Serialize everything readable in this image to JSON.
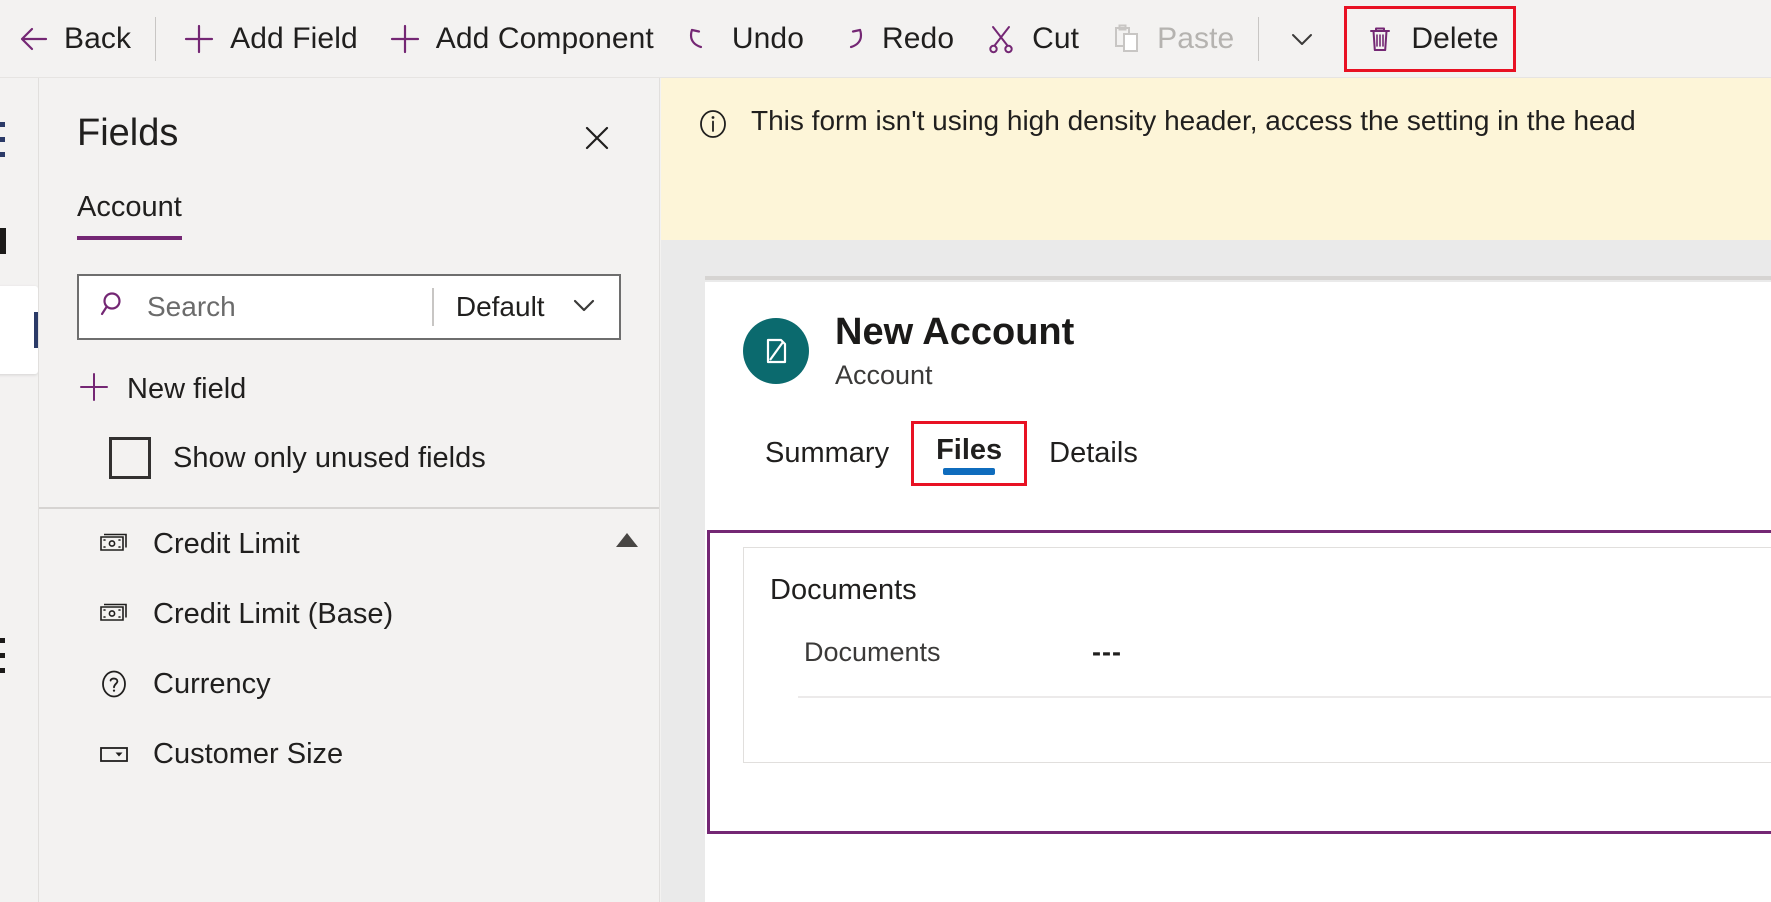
{
  "commandbar": {
    "items": [
      {
        "name": "back",
        "label": "Back",
        "icon": "arrow-left-icon",
        "disabled": false,
        "highlighted": false
      },
      {
        "name": "add-field",
        "label": "Add Field",
        "icon": "plus-icon",
        "disabled": false,
        "highlighted": false
      },
      {
        "name": "add-component",
        "label": "Add Component",
        "icon": "plus-icon",
        "disabled": false,
        "highlighted": false
      },
      {
        "name": "undo",
        "label": "Undo",
        "icon": "undo-icon",
        "disabled": false,
        "highlighted": false
      },
      {
        "name": "redo",
        "label": "Redo",
        "icon": "redo-icon",
        "disabled": false,
        "highlighted": false
      },
      {
        "name": "cut",
        "label": "Cut",
        "icon": "scissors-icon",
        "disabled": false,
        "highlighted": false
      },
      {
        "name": "paste",
        "label": "Paste",
        "icon": "clipboard-icon",
        "disabled": true,
        "highlighted": false
      },
      {
        "name": "paste-more",
        "label": "",
        "icon": "chevron-down-icon",
        "disabled": false,
        "highlighted": false
      },
      {
        "name": "delete",
        "label": "Delete",
        "icon": "trash-icon",
        "disabled": false,
        "highlighted": true
      }
    ]
  },
  "fields_panel": {
    "title": "Fields",
    "close_icon": "close-icon",
    "entity_tab": "Account",
    "search": {
      "icon": "search-icon",
      "placeholder": "Search",
      "value": ""
    },
    "view_select": {
      "value": "Default",
      "icon": "chevron-down-icon"
    },
    "new_field": {
      "label": "New field",
      "icon": "plus-icon"
    },
    "show_unused": {
      "label": "Show only unused fields",
      "checked": false
    },
    "scroll_up_icon": "triangle-up-icon",
    "field_list": [
      {
        "label": "Credit Limit",
        "icon": "currency-icon"
      },
      {
        "label": "Credit Limit (Base)",
        "icon": "currency-icon"
      },
      {
        "label": "Currency",
        "icon": "lookup-icon"
      },
      {
        "label": "Customer Size",
        "icon": "choice-icon"
      }
    ]
  },
  "notification": {
    "icon": "info-icon",
    "text": "This form isn't using high density header, access the setting in the head"
  },
  "form": {
    "record_title": "New Account",
    "record_subtitle": "Account",
    "avatar_icon": "account-entity-icon",
    "tabs": [
      {
        "label": "Summary",
        "active": false,
        "highlighted": false
      },
      {
        "label": "Files",
        "active": true,
        "highlighted": true
      },
      {
        "label": "Details",
        "active": false,
        "highlighted": false
      }
    ],
    "section": {
      "title": "Documents",
      "rows": [
        {
          "label": "Documents",
          "value": "---"
        }
      ]
    }
  },
  "colors": {
    "brand_purple": "#742774",
    "highlight_red": "#e81123",
    "tab_underline_blue": "#0f6cbd",
    "notification_bg": "#fdf5d8",
    "avatar_teal": "#0b6a6e",
    "canvas_bg": "#eaeaea",
    "panel_bg": "#f3f2f1"
  }
}
